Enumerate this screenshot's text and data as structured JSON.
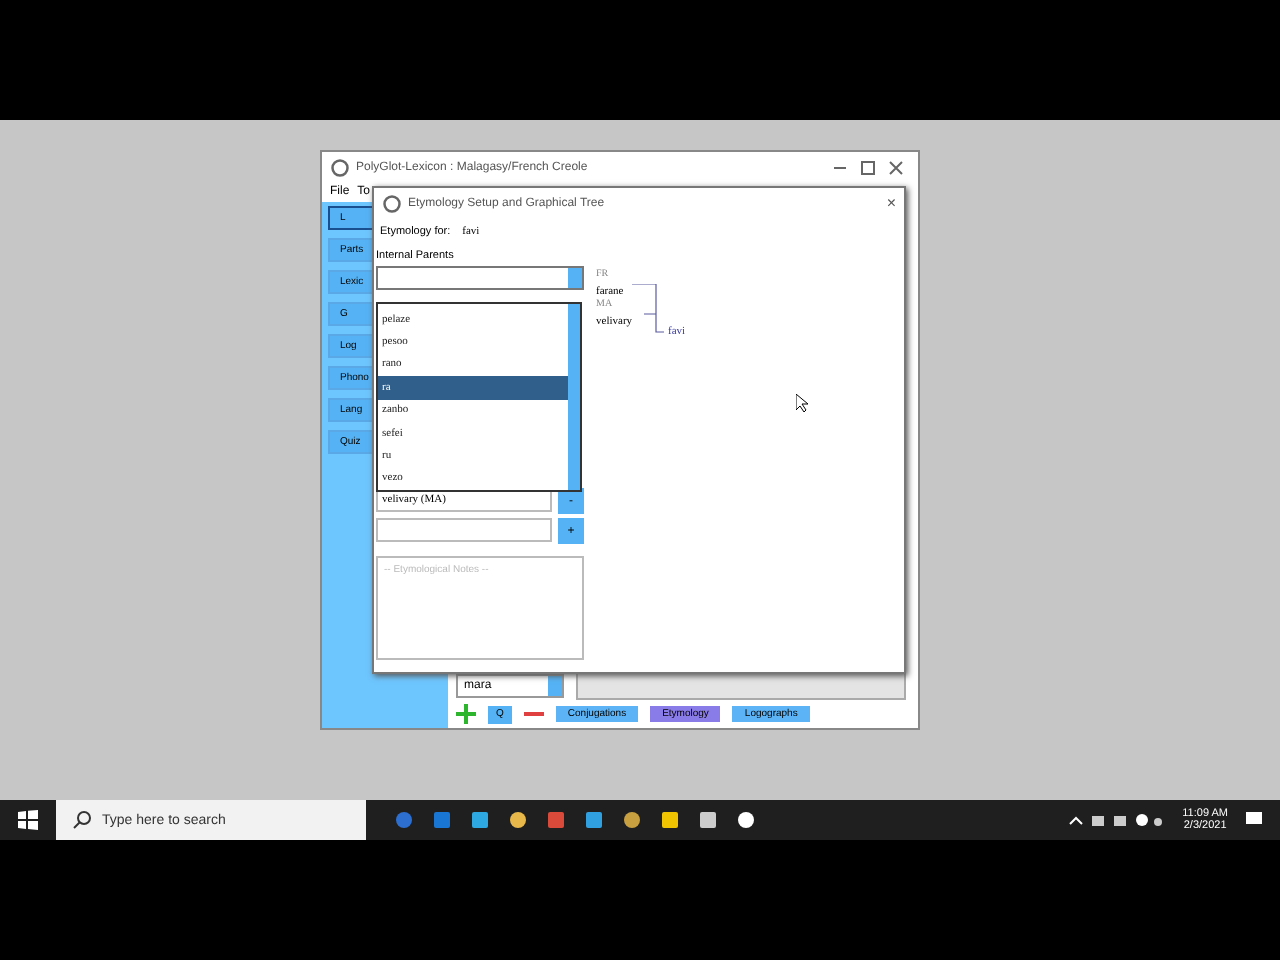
{
  "main_window": {
    "title": "PolyGlot-Lexicon : Malagasy/French Creole",
    "menu": [
      "File",
      "To"
    ],
    "sidebar": [
      {
        "label": "L",
        "selected": true
      },
      {
        "label": "Parts",
        "selected": false
      },
      {
        "label": "Lexic",
        "selected": false
      },
      {
        "label": "G",
        "selected": false
      },
      {
        "label": "Log",
        "selected": false
      },
      {
        "label": "Phono",
        "selected": false
      },
      {
        "label": "Lang",
        "selected": false
      },
      {
        "label": "Quiz",
        "selected": false
      }
    ],
    "word_field": "mara",
    "search_button": "Q",
    "tabs": [
      {
        "label": "Conjugations",
        "selected": false
      },
      {
        "label": "Etymology",
        "selected": true
      },
      {
        "label": "Logographs",
        "selected": false
      }
    ]
  },
  "dialog": {
    "title": "Etymology Setup and Graphical Tree",
    "close": "×",
    "etymology_for_label": "Etymology for:",
    "word": "favi",
    "parents_label": "Internal Parents",
    "options": [
      {
        "label": "pelaze",
        "selected": false
      },
      {
        "label": "pesoo",
        "selected": false
      },
      {
        "label": "rano",
        "selected": false
      },
      {
        "label": "ra",
        "selected": true
      },
      {
        "label": "zanbo",
        "selected": false
      },
      {
        "label": "sefei",
        "selected": false
      },
      {
        "label": "ru",
        "selected": false
      },
      {
        "label": "vezo",
        "selected": false
      }
    ],
    "parents": [
      {
        "value": "velivary (MA)",
        "button": "-"
      },
      {
        "button": "+"
      }
    ],
    "notes_placeholder": "-- Etymological Notes --",
    "tree": {
      "parents": [
        {
          "lang": "FR",
          "word": "farane"
        },
        {
          "lang": "MA",
          "word": "velivary"
        }
      ],
      "child": "favi"
    }
  },
  "taskbar": {
    "search_placeholder": "Type here to search",
    "time": "11:09 AM",
    "date": "2/3/2021"
  }
}
